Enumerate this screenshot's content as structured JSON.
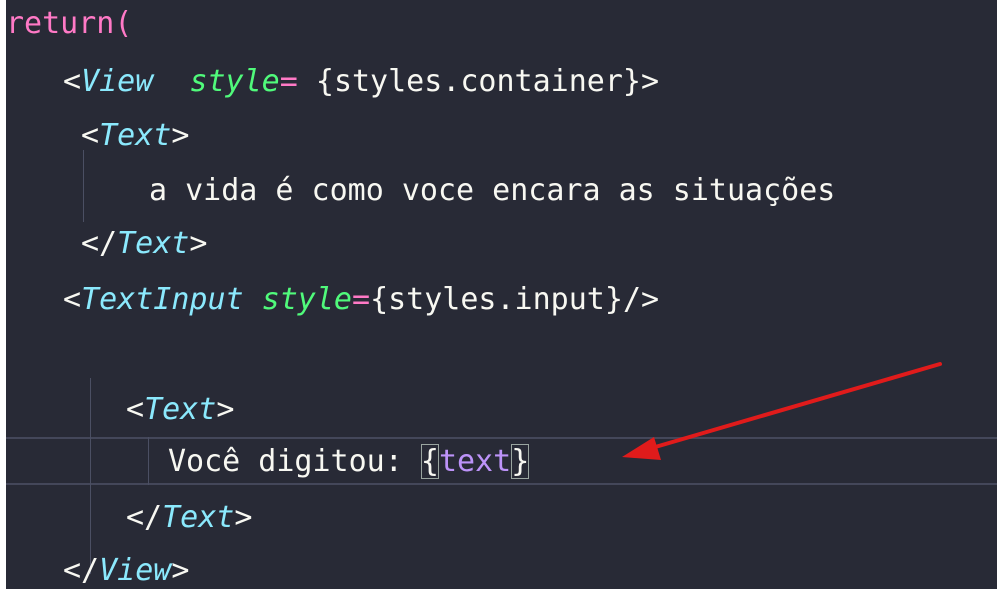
{
  "code": {
    "line1": {
      "keyword": "return("
    },
    "line2": {
      "open": "<",
      "tag": "View",
      "attr": "style",
      "eq": "= ",
      "lbrace": "{",
      "value": "styles.container",
      "rbrace": "}",
      "close": ">"
    },
    "line3": {
      "open": "<",
      "tag": "Text",
      "close": ">"
    },
    "line4": {
      "text": "a vida é como voce encara as situações"
    },
    "line5": {
      "open": "</",
      "tag": "Text",
      "close": ">"
    },
    "line6": {
      "open": "<",
      "tag": "TextInput",
      "attr": "style",
      "eq": "=",
      "lbrace": "{",
      "value": "styles.input",
      "rbrace": "}",
      "close": "/>"
    },
    "line8": {
      "open": "<",
      "tag": "Text",
      "close": ">"
    },
    "line9": {
      "label": "Você digitou: ",
      "lbrace": "{",
      "value": "text",
      "rbrace": "}"
    },
    "line10": {
      "open": "</",
      "tag": "Text",
      "close": ">"
    },
    "line11": {
      "open": "</",
      "tag": "View",
      "close": ">"
    }
  },
  "colors": {
    "background": "#282a36",
    "keyword": "#ff79c6",
    "tag": "#8be9fd",
    "attribute": "#50fa7b",
    "value": "#bd93f9",
    "text": "#f8f8f2",
    "arrow": "#e01b1b"
  }
}
